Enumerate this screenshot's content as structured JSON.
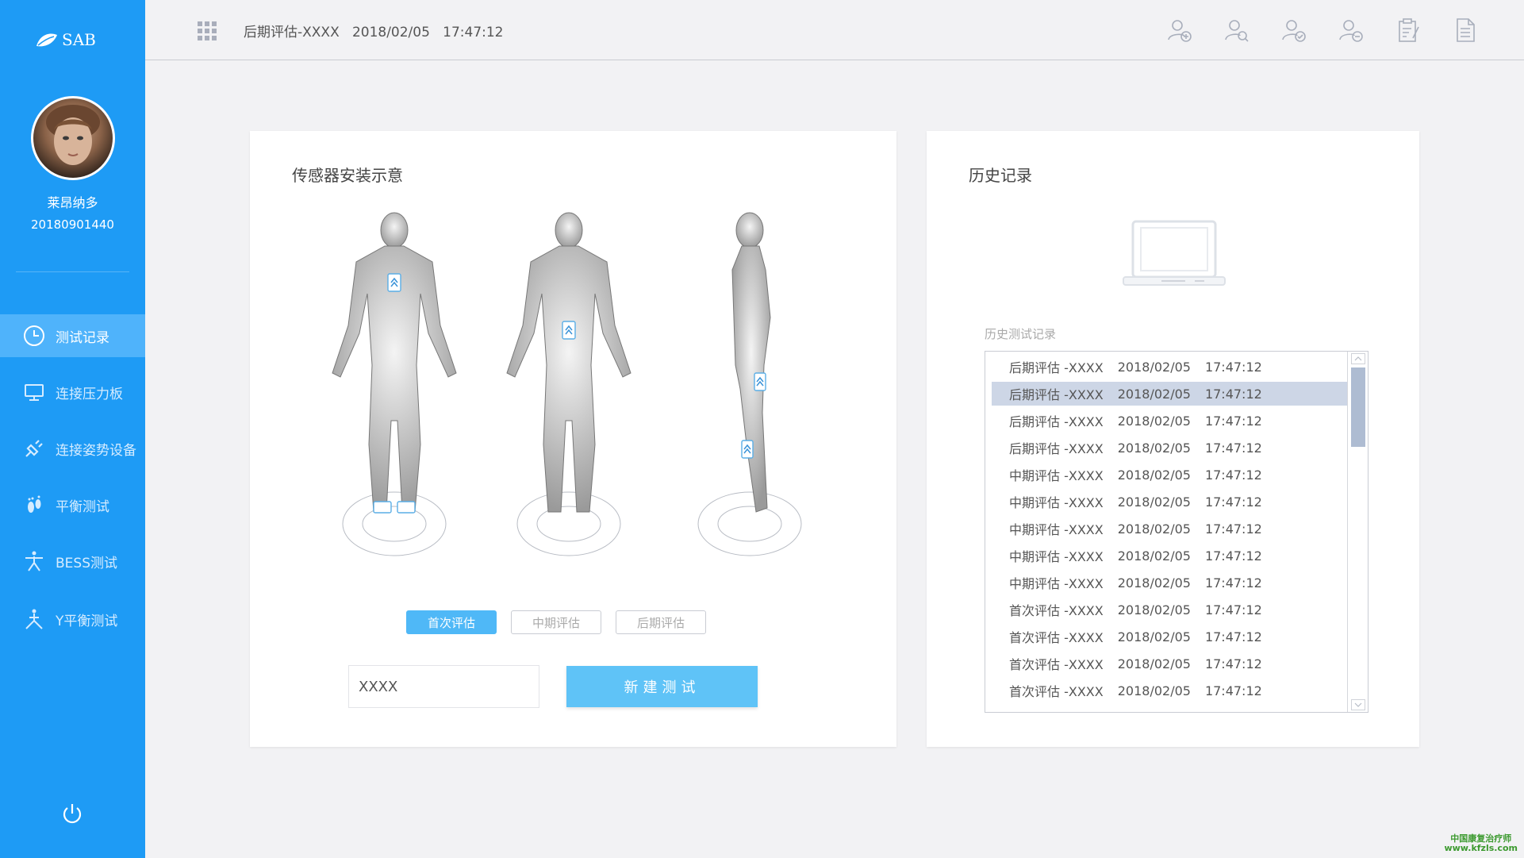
{
  "app": {
    "logo_text": "SAB"
  },
  "user": {
    "name": "莱昂纳多",
    "id": "20180901440"
  },
  "nav": [
    {
      "label": "测试记录",
      "icon": "clock-icon",
      "active": true
    },
    {
      "label": "连接压力板",
      "icon": "monitor-icon",
      "active": false
    },
    {
      "label": "连接姿势设备",
      "icon": "plug-icon",
      "active": false
    },
    {
      "label": "平衡测试",
      "icon": "footprint-icon",
      "active": false
    },
    {
      "label": "BESS测试",
      "icon": "person-icon",
      "active": false
    },
    {
      "label": "Y平衡测试",
      "icon": "y-balance-icon",
      "active": false
    }
  ],
  "header": {
    "title": "后期评估-XXXX",
    "date": "2018/02/05",
    "time": "17:47:12"
  },
  "top_icons": [
    "add-user-icon",
    "search-user-icon",
    "verify-user-icon",
    "remove-user-icon",
    "clipboard-icon",
    "document-icon"
  ],
  "sensor_panel": {
    "title": "传感器安装示意",
    "tabs": [
      "首次评估",
      "中期评估",
      "后期评估"
    ],
    "active_tab": 0,
    "input_value": "XXXX",
    "new_button": "新建测试"
  },
  "history_panel": {
    "title": "历史记录",
    "list_label": "历史测试记录",
    "selected_index": 1,
    "rows": [
      {
        "name": "后期评估 -XXXX",
        "date": "2018/02/05",
        "time": "17:47:12"
      },
      {
        "name": "后期评估 -XXXX",
        "date": "2018/02/05",
        "time": "17:47:12"
      },
      {
        "name": "后期评估 -XXXX",
        "date": "2018/02/05",
        "time": "17:47:12"
      },
      {
        "name": "后期评估 -XXXX",
        "date": "2018/02/05",
        "time": "17:47:12"
      },
      {
        "name": "中期评估 -XXXX",
        "date": "2018/02/05",
        "time": "17:47:12"
      },
      {
        "name": "中期评估 -XXXX",
        "date": "2018/02/05",
        "time": "17:47:12"
      },
      {
        "name": "中期评估 -XXXX",
        "date": "2018/02/05",
        "time": "17:47:12"
      },
      {
        "name": "中期评估 -XXXX",
        "date": "2018/02/05",
        "time": "17:47:12"
      },
      {
        "name": "中期评估 -XXXX",
        "date": "2018/02/05",
        "time": "17:47:12"
      },
      {
        "name": "首次评估 -XXXX",
        "date": "2018/02/05",
        "time": "17:47:12"
      },
      {
        "name": "首次评估 -XXXX",
        "date": "2018/02/05",
        "time": "17:47:12"
      },
      {
        "name": "首次评估 -XXXX",
        "date": "2018/02/05",
        "time": "17:47:12"
      },
      {
        "name": "首次评估 -XXXX",
        "date": "2018/02/05",
        "time": "17:47:12"
      }
    ]
  },
  "watermark": {
    "line1": "中国康复治疗师",
    "line2": "www.kfzls.com"
  },
  "colors": {
    "sidebar": "#1e9bf5",
    "nav_active": "#4fb3fb",
    "button": "#5fc3f7",
    "selected_row": "#cdd6e6"
  }
}
